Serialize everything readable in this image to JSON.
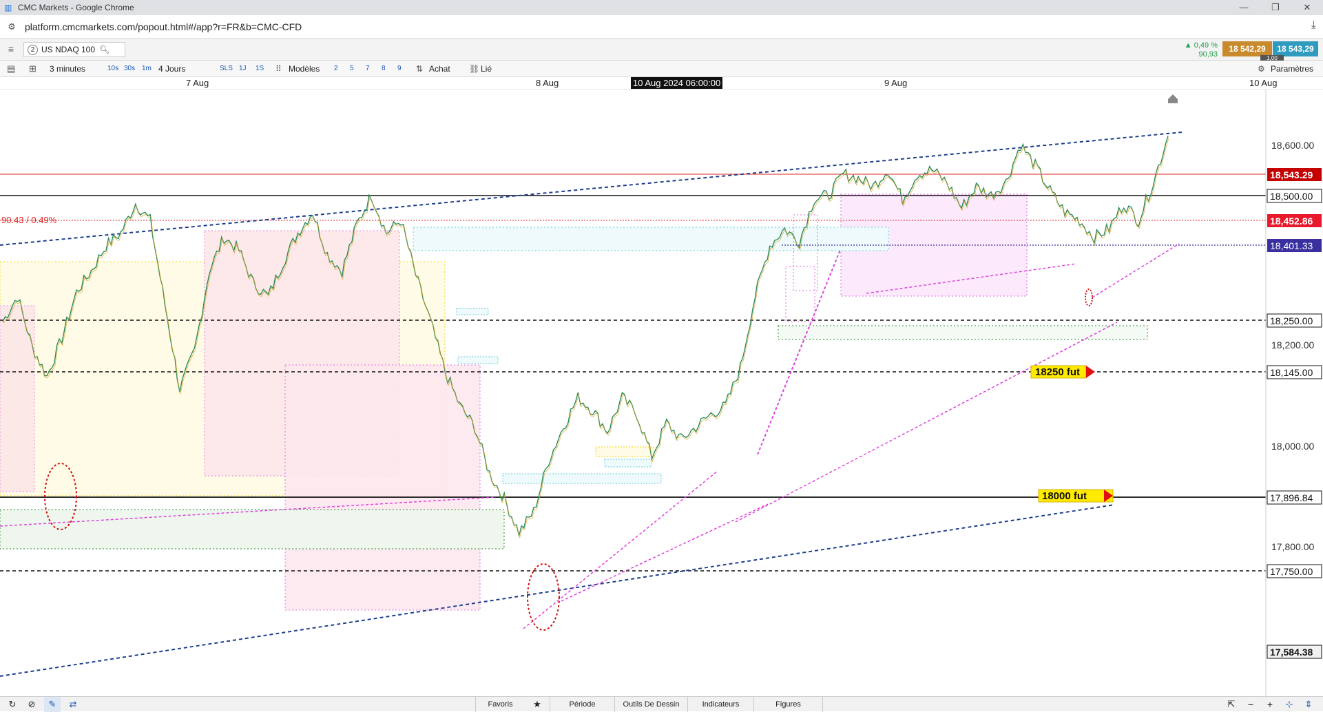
{
  "window": {
    "title": "CMC Markets - Google Chrome",
    "url": "platform.cmcmarkets.com/popout.html#/app?r=FR&b=CMC-CFD"
  },
  "instrument": {
    "index": "2",
    "name": "US NDAQ 100",
    "change_pct": "▲ 0,49 %",
    "change_abs": "90,93",
    "sell": "18 542,29",
    "buy": "18 543,29",
    "spread": "1,00"
  },
  "toolbar": {
    "timeframe": "3 minutes",
    "intervals": [
      "10s",
      "30s",
      "1m"
    ],
    "period": "4 Jours",
    "periods": [
      "SLS",
      "1J",
      "1S"
    ],
    "models": "Modèles",
    "layouts": [
      "2",
      "5",
      "7",
      "8",
      "9"
    ],
    "buy": "Achat",
    "linked": "Lié",
    "settings": "Paramètres"
  },
  "dates": {
    "d1": "7 Aug",
    "d2": "8 Aug",
    "cursor": "10 Aug 2024 06:00:00",
    "d3": "9 Aug",
    "d4": "10 Aug"
  },
  "chart_data": {
    "type": "line",
    "y_ticks": [
      "18,600.00",
      "18,200.00",
      "18,000.00",
      "17,800.00"
    ],
    "price_tags": [
      {
        "label": "18,543.29",
        "color": "#c40000"
      },
      {
        "label": "18,500.00",
        "color": "#111111"
      },
      {
        "label": "18,452.86",
        "color": "#e8192c"
      },
      {
        "label": "18,401.33",
        "color": "#3a2f9e"
      },
      {
        "label": "18,250.00",
        "color": "#111111"
      },
      {
        "label": "18,145.00",
        "color": "#111111"
      },
      {
        "label": "17,896.84",
        "color": "#111111"
      },
      {
        "label": "17,750.00",
        "color": "#111111"
      },
      {
        "label": "17,584.38",
        "color": "#111111"
      }
    ],
    "change_label": "90.43 / 0.49%",
    "annotations": [
      "18250 fut",
      "18000 fut"
    ],
    "series_prices": [
      18120,
      18180,
      18060,
      17990,
      18080,
      18190,
      18240,
      18300,
      18330,
      18400,
      18360,
      18160,
      17960,
      18050,
      18240,
      18320,
      18290,
      18210,
      18180,
      18260,
      18330,
      18380,
      18280,
      18240,
      18350,
      18420,
      18330,
      18360,
      18230,
      18120,
      18000,
      17920,
      17870,
      17760,
      17700,
      17620,
      17670,
      17790,
      17870,
      17940,
      17910,
      17860,
      17940,
      17900,
      17800,
      17880,
      17840,
      17870,
      17900,
      17920,
      18010,
      18180,
      18300,
      18340,
      18310,
      18410,
      18420,
      18470,
      18460,
      18440,
      18480,
      18410,
      18470,
      18480,
      18450,
      18390,
      18440,
      18420,
      18450,
      18540,
      18490,
      18430,
      18380,
      18360,
      18320,
      18340,
      18400,
      18360,
      18450,
      18560
    ]
  },
  "bottom": {
    "favorites": "Favoris",
    "period": "Période",
    "drawing_tools": "Outils De Dessin",
    "indicators": "Indicateurs",
    "figures": "Figures"
  },
  "colors": {
    "accent_sell": "#c98a2e",
    "accent_buy": "#2f9bbf",
    "trend_blue": "#1d3e8f",
    "trend_magenta": "#e040e0"
  }
}
